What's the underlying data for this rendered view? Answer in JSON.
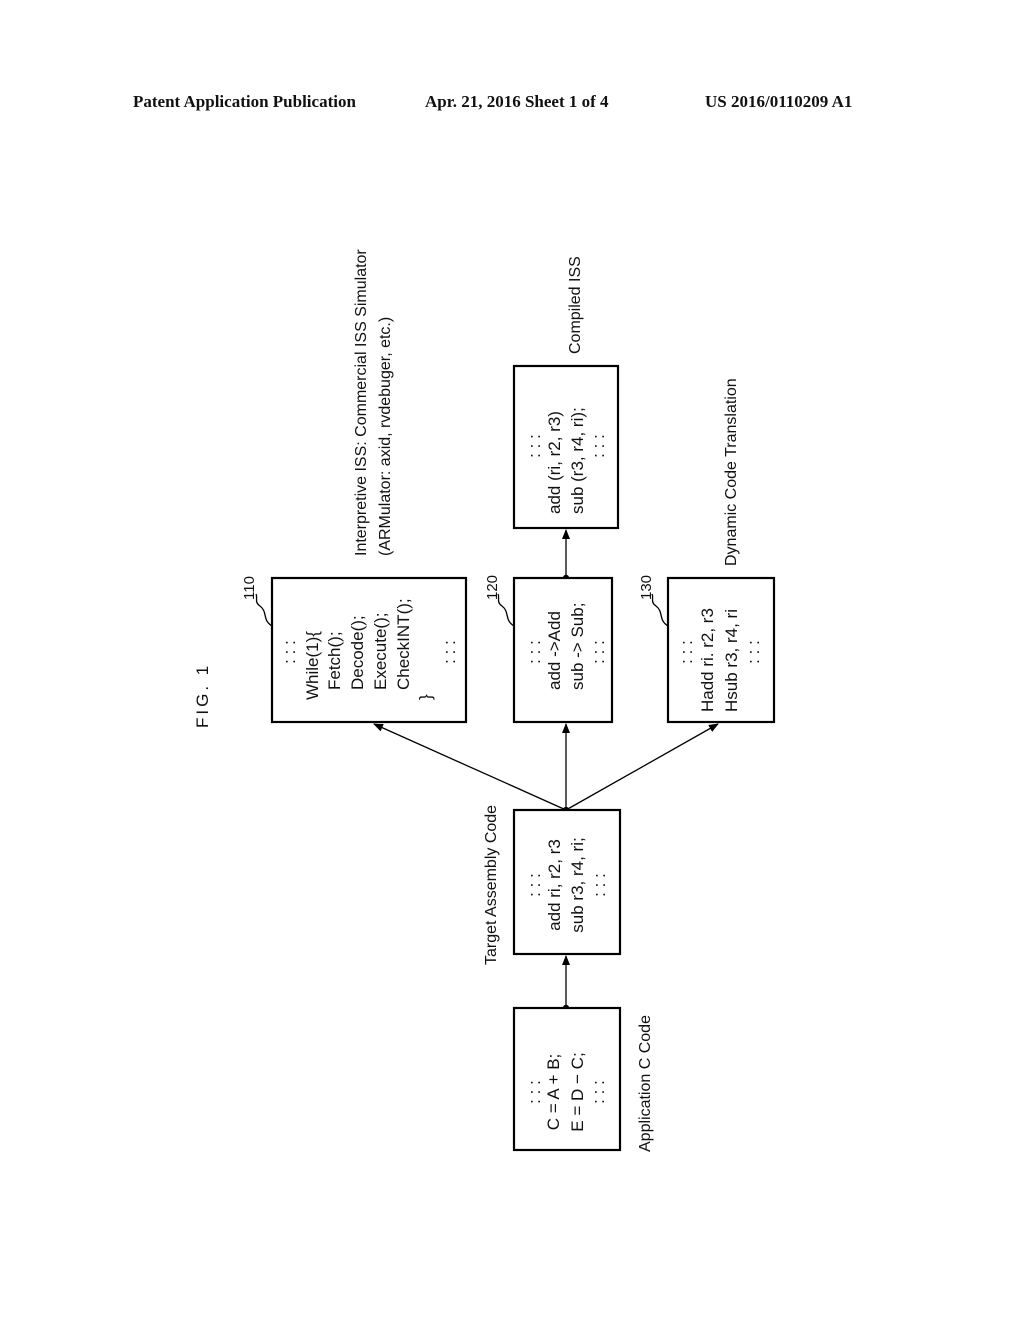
{
  "header": {
    "publication": "Patent Application Publication",
    "date_sheet": "Apr. 21, 2016  Sheet 1 of 4",
    "number": "US 2016/0110209 A1"
  },
  "figure": {
    "label": "FIG. 1",
    "orientation": "rotated 90° counterclockwise",
    "nodes": {
      "app_c": {
        "caption": "Application C Code",
        "lines": [
          ": : :",
          "C = A + B;",
          "E = D − C;",
          ": : :"
        ]
      },
      "target_asm": {
        "caption": "Target Assembly Code",
        "lines": [
          ": : :",
          "add ri, r2, r3",
          "sub r3, r4, ri;",
          ": : :"
        ]
      },
      "interp": {
        "ref": "110",
        "caption_line1": "Interpretive ISS: Commercial ISS Simulator",
        "caption_line2": "(ARMulator: axid, rvdebuger, etc.)",
        "lines": [
          ": : :",
          "While(1){",
          "Fetch();",
          "Decode();",
          "Execute();",
          "CheckINT();",
          "}",
          ": : :"
        ]
      },
      "compiled_map": {
        "ref": "120",
        "lines": [
          ": : :",
          "add ->Add",
          "sub -> Sub;",
          ": : :"
        ]
      },
      "compiled_iss": {
        "caption": "Compiled ISS",
        "lines": [
          ": : :",
          "add (ri, r2, r3)",
          "sub (r3, r4, ri);",
          ": : :"
        ]
      },
      "dynamic": {
        "ref": "130",
        "caption": "Dynamic Code Translation",
        "lines": [
          ": : :",
          "Hadd ri. r2, r3",
          "Hsub r3, r4, ri",
          ": : :"
        ]
      }
    },
    "edges": [
      {
        "from": "app_c",
        "to": "target_asm"
      },
      {
        "from": "target_asm",
        "to": "interp"
      },
      {
        "from": "target_asm",
        "to": "compiled_map"
      },
      {
        "from": "target_asm",
        "to": "dynamic"
      },
      {
        "from": "compiled_map",
        "to": "compiled_iss"
      }
    ]
  }
}
